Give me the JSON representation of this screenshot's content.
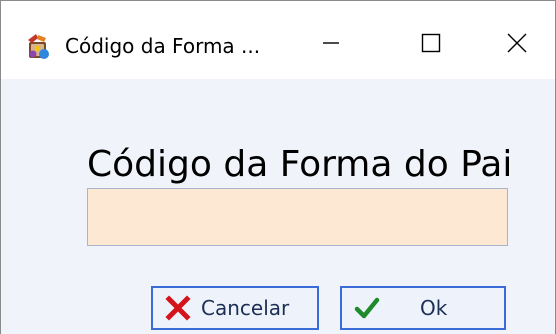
{
  "window": {
    "title": "Código da Forma ...",
    "app_icon": "app-icon",
    "controls": {
      "minimize": "minimize-icon",
      "maximize": "maximize-icon",
      "close": "close-icon"
    }
  },
  "form": {
    "label": "Código da Forma do Pai",
    "input_value": "",
    "input_background": "#fde9d3"
  },
  "buttons": {
    "cancel_label": "Cancelar",
    "cancel_icon": "x-icon",
    "cancel_icon_color": "#d4141a",
    "ok_label": "Ok",
    "ok_icon": "checkmark-icon",
    "ok_icon_color": "#1f8a2c",
    "border_color": "#3a6bd6"
  }
}
